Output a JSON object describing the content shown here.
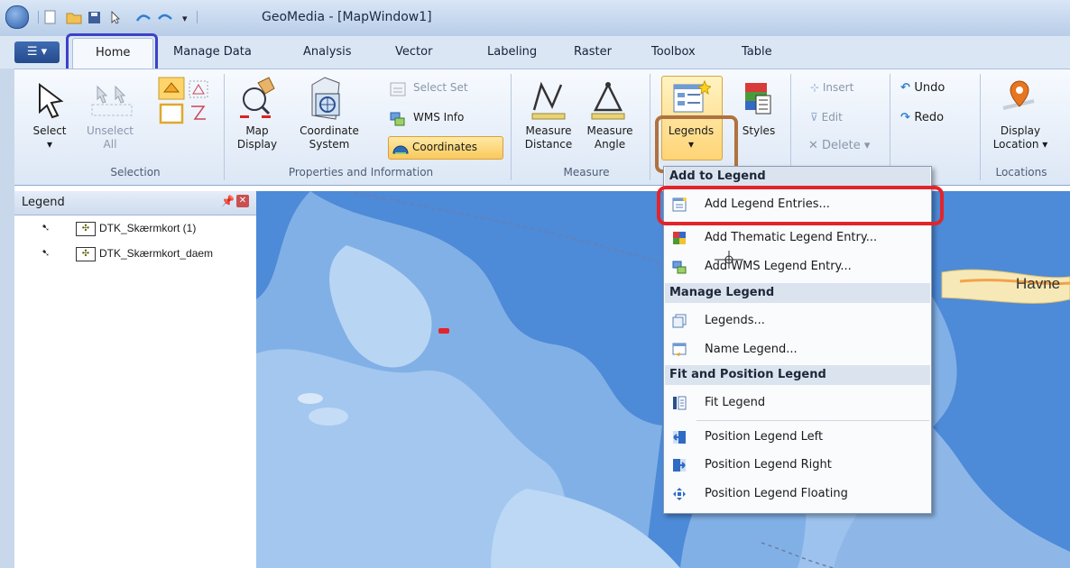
{
  "window": {
    "title": "GeoMedia - [MapWindow1]"
  },
  "tabs": [
    "Home",
    "Manage Data",
    "Analysis",
    "Vector",
    "Labeling",
    "Raster",
    "Toolbox",
    "Table"
  ],
  "ribbon": {
    "selection": {
      "select": "Select",
      "unselect_line1": "Unselect",
      "unselect_line2": "All",
      "group": "Selection"
    },
    "properties": {
      "map_display_1": "Map",
      "map_display_2": "Display",
      "coord_sys_1": "Coordinate",
      "coord_sys_2": "System",
      "select_set": "Select Set",
      "wms_info": "WMS Info",
      "coordinates": "Coordinates",
      "group": "Properties and Information"
    },
    "measure": {
      "m1": "Measure",
      "distance": "Distance",
      "m2": "Measure",
      "angle": "Angle",
      "group": "Measure"
    },
    "legends": {
      "legends": "Legends",
      "styles": "Styles"
    },
    "edit": {
      "insert": "Insert",
      "edit": "Edit",
      "delete": "Delete ▾",
      "undo": "Undo",
      "redo": "Redo"
    },
    "locations": {
      "display": "Display",
      "location": "Location ▾",
      "group": "Locations"
    }
  },
  "legend_panel": {
    "title": "Legend",
    "items": [
      "DTK_Skærmkort (1)",
      "DTK_Skærmkort_daem"
    ]
  },
  "map": {
    "label": "Havne"
  },
  "menu": {
    "sections": [
      {
        "header": "Add to Legend",
        "items": [
          "Add Legend Entries...",
          "Add Thematic Legend Entry...",
          "Add WMS Legend Entry..."
        ]
      },
      {
        "header": "Manage Legend",
        "items": [
          "Legends...",
          "Name Legend..."
        ]
      },
      {
        "header": "Fit and Position Legend",
        "items": [
          "Fit Legend",
          "Position Legend Left",
          "Position Legend Right",
          "Position Legend Floating"
        ]
      }
    ]
  },
  "colors": {
    "highlight_blue": "#3c42c8",
    "highlight_brown": "#b0723f",
    "highlight_red": "#e3242b",
    "water_deep": "#4a87d6",
    "water_shallow": "#a9cbef"
  }
}
